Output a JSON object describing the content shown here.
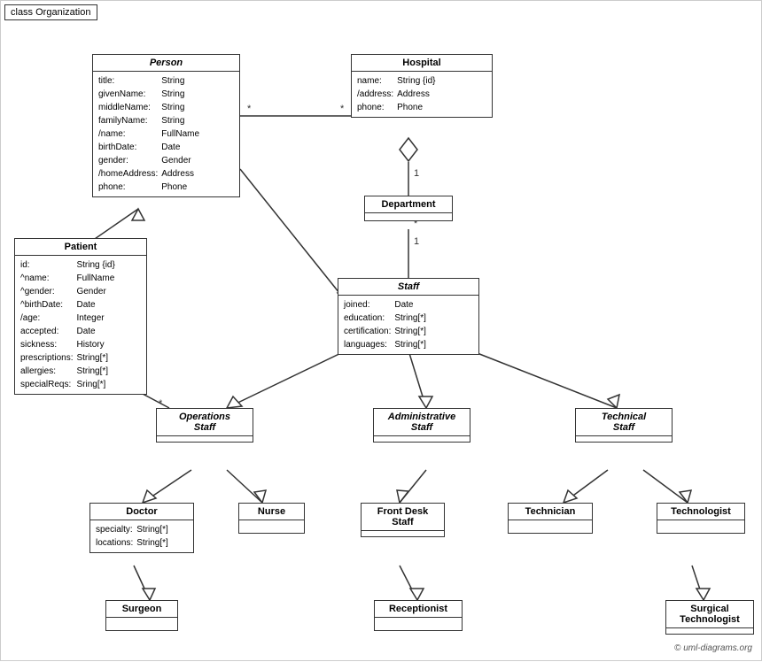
{
  "diagram": {
    "title": "class Organization",
    "classes": {
      "person": {
        "name": "Person",
        "italic": true,
        "attrs": [
          [
            "title:",
            "String"
          ],
          [
            "givenName:",
            "String"
          ],
          [
            "middleName:",
            "String"
          ],
          [
            "familyName:",
            "String"
          ],
          [
            "/name:",
            "FullName"
          ],
          [
            "birthDate:",
            "Date"
          ],
          [
            "gender:",
            "Gender"
          ],
          [
            "/homeAddress:",
            "Address"
          ],
          [
            "phone:",
            "Phone"
          ]
        ]
      },
      "hospital": {
        "name": "Hospital",
        "italic": false,
        "attrs": [
          [
            "name:",
            "String {id}"
          ],
          [
            "/address:",
            "Address"
          ],
          [
            "phone:",
            "Phone"
          ]
        ]
      },
      "department": {
        "name": "Department",
        "italic": false,
        "attrs": []
      },
      "staff": {
        "name": "Staff",
        "italic": true,
        "attrs": [
          [
            "joined:",
            "Date"
          ],
          [
            "education:",
            "String[*]"
          ],
          [
            "certification:",
            "String[*]"
          ],
          [
            "languages:",
            "String[*]"
          ]
        ]
      },
      "patient": {
        "name": "Patient",
        "italic": false,
        "attrs": [
          [
            "id:",
            "String {id}"
          ],
          [
            "^name:",
            "FullName"
          ],
          [
            "^gender:",
            "Gender"
          ],
          [
            "^birthDate:",
            "Date"
          ],
          [
            "/age:",
            "Integer"
          ],
          [
            "accepted:",
            "Date"
          ],
          [
            "sickness:",
            "History"
          ],
          [
            "prescriptions:",
            "String[*]"
          ],
          [
            "allergies:",
            "String[*]"
          ],
          [
            "specialReqs:",
            "Sring[*]"
          ]
        ]
      },
      "operations_staff": {
        "name": "Operations Staff",
        "italic": true
      },
      "administrative_staff": {
        "name": "Administrative Staff",
        "italic": true
      },
      "technical_staff": {
        "name": "Technical Staff",
        "italic": true
      },
      "doctor": {
        "name": "Doctor",
        "italic": false,
        "attrs": [
          [
            "specialty:",
            "String[*]"
          ],
          [
            "locations:",
            "String[*]"
          ]
        ]
      },
      "nurse": {
        "name": "Nurse",
        "italic": false,
        "attrs": []
      },
      "front_desk_staff": {
        "name": "Front Desk Staff",
        "italic": false,
        "attrs": []
      },
      "technician": {
        "name": "Technician",
        "italic": false,
        "attrs": []
      },
      "technologist": {
        "name": "Technologist",
        "italic": false,
        "attrs": []
      },
      "surgeon": {
        "name": "Surgeon",
        "italic": false,
        "attrs": []
      },
      "receptionist": {
        "name": "Receptionist",
        "italic": false,
        "attrs": []
      },
      "surgical_technologist": {
        "name": "Surgical Technologist",
        "italic": false,
        "attrs": []
      }
    },
    "copyright": "© uml-diagrams.org"
  }
}
